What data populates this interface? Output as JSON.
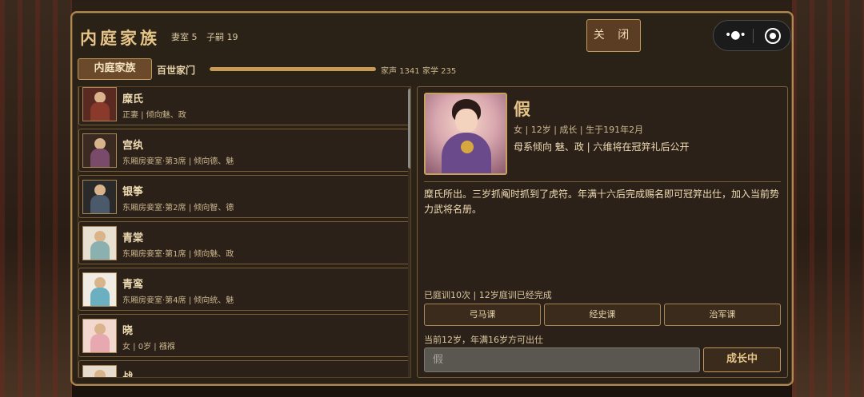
{
  "header": {
    "title": "内庭家族",
    "wives_label": "妻室 5",
    "heirs_label": "子嗣 19",
    "close_label": "关 闭"
  },
  "tabs": {
    "active": "内庭家族",
    "second": "百世家门"
  },
  "clan": {
    "progress": 1.0,
    "fame_label": "家声 1341",
    "learning_label": "家学 235"
  },
  "members": [
    {
      "name": "糜氏",
      "desc": "正妻 | 倾向魅、政",
      "robe": "#8a3a2a"
    },
    {
      "name": "宫纨",
      "desc": "东厢房妾室·第3席 | 倾向德、魅",
      "robe": "#7a4a6a"
    },
    {
      "name": "银筝",
      "desc": "东厢房妾室·第2席 | 倾向智、德",
      "robe": "#4a5a6a"
    },
    {
      "name": "青棠",
      "desc": "东厢房妾室·第1席 | 倾向魅、政",
      "robe": "#8ab0b0"
    },
    {
      "name": "青鸾",
      "desc": "东厢房妾室·第4席 | 倾向统、魅",
      "robe": "#6ab0c0"
    },
    {
      "name": "晓",
      "desc": "女 | 0岁 | 襁褓",
      "robe": "#e8a8b0"
    },
    {
      "name": "战",
      "desc": "",
      "robe": "#c8b090"
    }
  ],
  "detail": {
    "name": "假",
    "meta": "女 | 12岁 | 成长 | 生于191年2月",
    "trait": "母系倾向 魅、政 | 六维将在冠笄礼后公开",
    "description": "糜氏所出。三岁抓阄时抓到了虎符。年满十六后完成赐名即可冠笄出仕，加入当前势力武将名册。",
    "training": "已庭训10次 | 12岁庭训已经完成",
    "courses": [
      "弓马课",
      "经史课",
      "治军课"
    ],
    "note": "当前12岁，年满16岁方可出仕",
    "input_placeholder": "假",
    "grow_label": "成长中"
  },
  "colors": {
    "accent": "#e6c487",
    "border": "#b08a52",
    "panel": "#2a2117"
  }
}
